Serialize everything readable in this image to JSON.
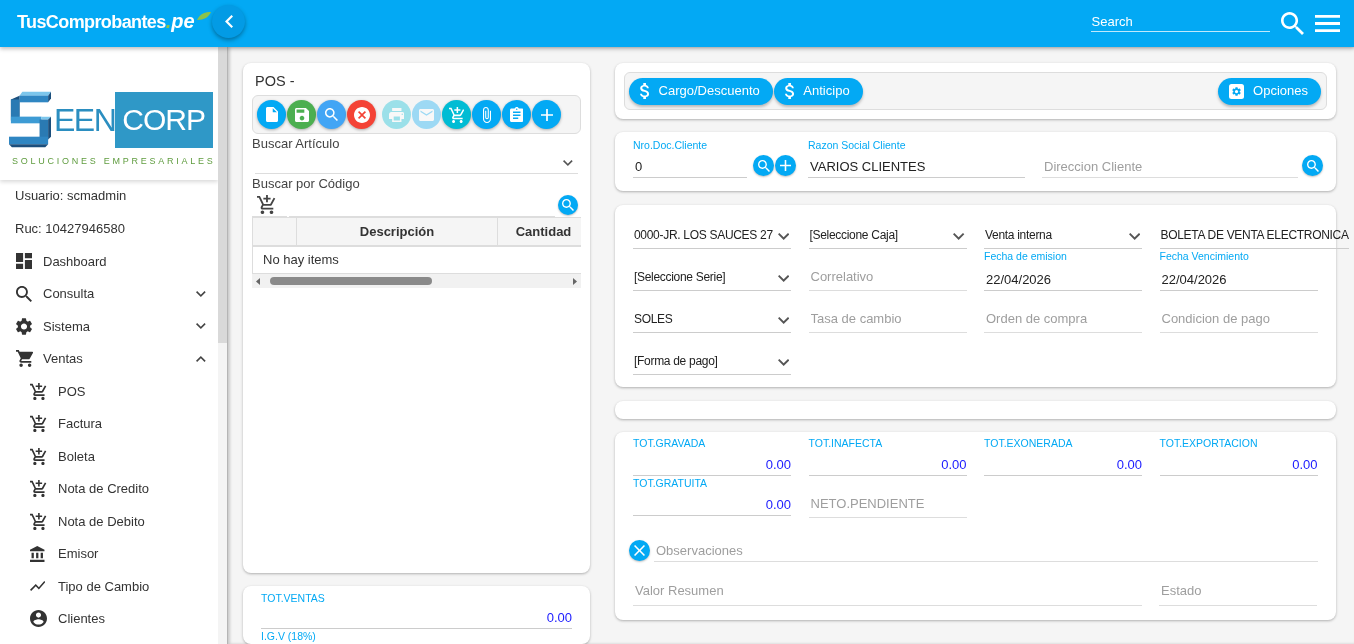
{
  "topbar": {
    "brand": "TusComprobantes",
    "brand_suffix": ".pe",
    "search": {
      "placeholder": "Search"
    }
  },
  "sidebar": {
    "logo": {
      "wordmark": "EEN",
      "wordmark_box": "CORP",
      "tagline": "SOLUCIONES EMPRESARIALES"
    },
    "user": "Usuario: scmadmin",
    "ruc": "Ruc: 10427946580",
    "items": [
      {
        "label": "Dashboard",
        "kind": "dashboard"
      },
      {
        "label": "Consulta",
        "kind": "search",
        "expanded": false
      },
      {
        "label": "Sistema",
        "kind": "settings",
        "expanded": false
      },
      {
        "label": "Ventas",
        "kind": "cart",
        "expanded": true,
        "children": [
          {
            "label": "POS",
            "kind": "cart-plus"
          },
          {
            "label": "Factura",
            "kind": "cart-plus"
          },
          {
            "label": "Boleta",
            "kind": "cart-plus"
          },
          {
            "label": "Nota de Credito",
            "kind": "cart-plus"
          },
          {
            "label": "Nota de Debito",
            "kind": "cart-plus"
          },
          {
            "label": "Emisor",
            "kind": "bank"
          },
          {
            "label": "Tipo de Cambio",
            "kind": "chart"
          },
          {
            "label": "Clientes",
            "kind": "account"
          }
        ]
      }
    ]
  },
  "pos": {
    "title": "POS -",
    "toolbar": [
      {
        "kind": "new",
        "disabled": false
      },
      {
        "kind": "save",
        "disabled": false
      },
      {
        "kind": "search",
        "disabled": false
      },
      {
        "kind": "cancel",
        "disabled": false
      },
      {
        "kind": "print",
        "disabled": true
      },
      {
        "kind": "email",
        "disabled": true
      },
      {
        "kind": "cart",
        "disabled": false
      },
      {
        "kind": "attach",
        "disabled": false
      },
      {
        "kind": "clipboard",
        "disabled": false
      },
      {
        "kind": "add",
        "disabled": false
      }
    ],
    "article_search": {
      "label": "Buscar Artículo"
    },
    "code_search": {
      "label": "Buscar por Código"
    },
    "table": {
      "columns": [
        "Descripción",
        "Cantidad"
      ],
      "empty_text": "No hay items"
    }
  },
  "pos_totals": [
    {
      "label": "TOT.VENTAS",
      "value": "0.00"
    },
    {
      "label": "I.G.V (18%)"
    }
  ],
  "actions": {
    "buttons": [
      {
        "label": "Cargo/Descuento",
        "kind": "money"
      },
      {
        "label": "Anticipo",
        "kind": "money"
      }
    ],
    "options": {
      "label": "Opciones"
    }
  },
  "client": {
    "doc_number": {
      "label": "Nro.Doc.Cliente",
      "value": "0"
    },
    "name": {
      "label": "Razon Social Cliente",
      "value": "VARIOS CLIENTES"
    },
    "address": {
      "placeholder": "Direccion Cliente"
    }
  },
  "document": {
    "rows": [
      [
        {
          "kind": "select",
          "value": "0000-JR. LOS SAUCES 27"
        },
        {
          "kind": "select",
          "value": "[Seleccione Caja]"
        },
        {
          "kind": "select",
          "value": "Venta interna"
        },
        {
          "kind": "select",
          "value": "BOLETA DE VENTA ELECTRONICA"
        }
      ],
      [
        {
          "kind": "select",
          "value": "[Seleccione Serie]"
        },
        {
          "kind": "input",
          "placeholder": "Correlativo"
        },
        {
          "kind": "input",
          "label": "Fecha de emision",
          "value": "22/04/2026"
        },
        {
          "kind": "input",
          "label": "Fecha Vencimiento",
          "value": "22/04/2026"
        }
      ],
      [
        {
          "kind": "select",
          "value": "SOLES"
        },
        {
          "kind": "input",
          "placeholder": "Tasa de cambio"
        },
        {
          "kind": "input",
          "placeholder": "Orden de compra"
        },
        {
          "kind": "input",
          "placeholder": "Condicion de pago"
        }
      ],
      [
        {
          "kind": "select",
          "value": "[Forma de pago]"
        }
      ]
    ]
  },
  "totals": {
    "fields": [
      {
        "kind": "amount",
        "label": "TOT.GRAVADA",
        "value": "0.00"
      },
      {
        "kind": "amount",
        "label": "TOT.INAFECTA",
        "value": "0.00"
      },
      {
        "kind": "amount",
        "label": "TOT.EXONERADA",
        "value": "0.00"
      },
      {
        "kind": "amount",
        "label": "TOT.EXPORTACION",
        "value": "0.00"
      },
      {
        "kind": "amount",
        "label": "TOT.GRATUITA",
        "value": "0.00"
      },
      {
        "kind": "input",
        "placeholder": "NETO.PENDIENTE"
      }
    ],
    "observaciones": {
      "placeholder": "Observaciones"
    },
    "valor_resumen": {
      "placeholder": "Valor Resumen"
    },
    "estado": {
      "placeholder": "Estado"
    }
  }
}
